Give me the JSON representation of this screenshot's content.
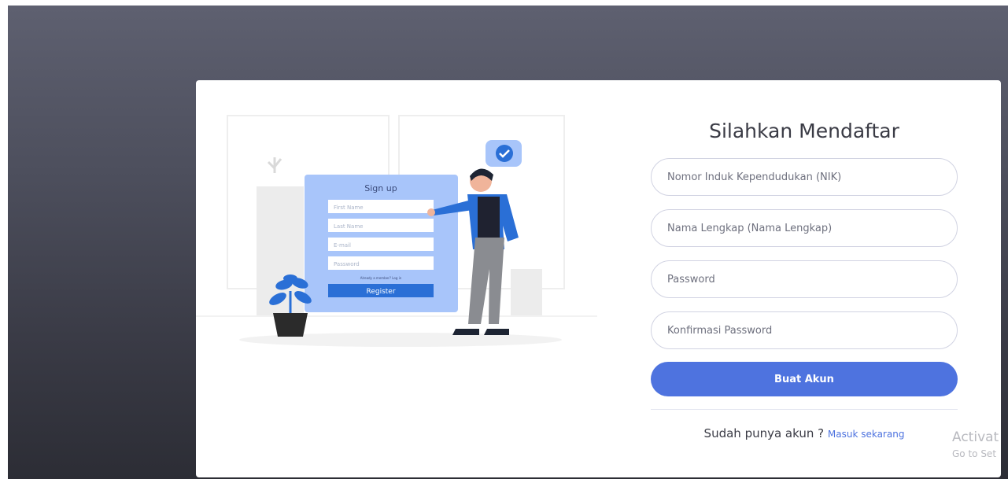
{
  "illustration": {
    "card_title": "Sign up",
    "fields": [
      "First Name",
      "Last Name",
      "E-mail",
      "Password"
    ],
    "login_hint": "Already a member? Log in",
    "button_label": "Register"
  },
  "form": {
    "title": "Silahkan Mendaftar",
    "nik_placeholder": "Nomor Induk Kependudukan (NIK)",
    "name_placeholder": "Nama Lengkap (Nama Lengkap)",
    "password_placeholder": "Password",
    "confirm_placeholder": "Konfirmasi Password",
    "submit_label": "Buat Akun"
  },
  "footer": {
    "question": "Sudah punya akun ? ",
    "login_link": "Masuk sekarang"
  },
  "watermark": {
    "line1": "Activat",
    "line2": "Go to Set"
  },
  "colors": {
    "primary": "#4e73df",
    "illustration_blue": "#2a6fd6",
    "illustration_card": "#a8c5fa"
  }
}
